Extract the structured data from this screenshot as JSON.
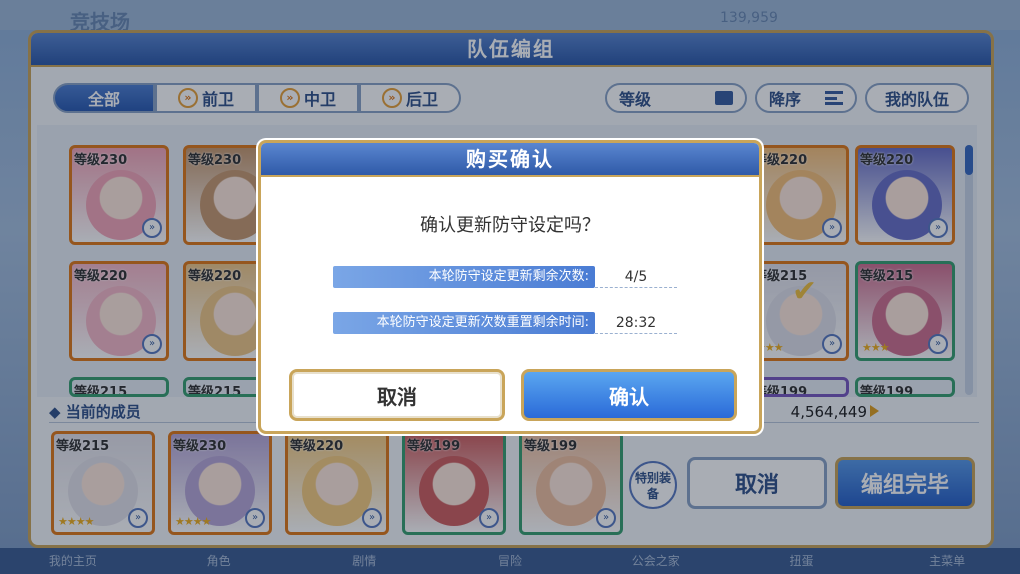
{
  "background": {
    "title": "竞技场",
    "number": "139,959",
    "nav": [
      "我的主页",
      "角色",
      "剧情",
      "冒险",
      "公会之家",
      "扭蛋",
      "主菜单"
    ]
  },
  "main": {
    "title": "队伍编组",
    "filters": [
      {
        "label": "全部",
        "icon": "all"
      },
      {
        "label": "前卫",
        "icon": "chevron-double-icon"
      },
      {
        "label": "中卫",
        "icon": "chevron-double-icon"
      },
      {
        "label": "后卫",
        "icon": "chevron-double-icon"
      }
    ],
    "sort": {
      "level_label": "等级",
      "order_label": "降序",
      "my_team_label": "我的队伍"
    },
    "grid_cards": [
      {
        "level": "等级230",
        "color": "#f4a6b8"
      },
      {
        "level": "等级230",
        "color": "#c89a70"
      },
      {
        "level": "等级220",
        "color": "#f6c07a"
      },
      {
        "level": "等级220",
        "color": "#6a70c8"
      },
      {
        "level": "等级220",
        "color": "#f6b8c8"
      },
      {
        "level": "等级220",
        "color": "#f0c888"
      },
      {
        "level": "等级215",
        "color": "#e0e0ea"
      },
      {
        "level": "等级215",
        "color": "#d07090"
      },
      {
        "level": "等级215",
        "color": "#a0c0e0"
      },
      {
        "level": "等级215",
        "color": "#b0d0a0"
      },
      {
        "level": "等级199",
        "color": "#e0b0c8"
      },
      {
        "level": "等级199",
        "color": "#c8c0e8"
      }
    ],
    "members_title": "当前的成员",
    "power": "4,564,449",
    "members": [
      {
        "level": "等级215",
        "color": "#e4e2ea",
        "stars": "★★★★",
        "frame": "orange"
      },
      {
        "level": "等级230",
        "color": "#b8a8d8",
        "stars": "★★★★",
        "frame": "orange"
      },
      {
        "level": "等级220",
        "color": "#f6cc80",
        "stars": "",
        "frame": "orange"
      },
      {
        "level": "等级199",
        "color": "#d06060",
        "stars": "",
        "frame": "green"
      },
      {
        "level": "等级199",
        "color": "#f0c0a0",
        "stars": "",
        "frame": "green"
      }
    ],
    "equip_label": "特别装备",
    "cancel_label": "取消",
    "complete_label": "编组完毕"
  },
  "dialog": {
    "title": "购买确认",
    "message": "确认更新防守设定吗？",
    "rows": [
      {
        "label": "本轮防守设定更新剩余次数:",
        "value": "4/5"
      },
      {
        "label": "本轮防守设定更新次数重置剩余时间:",
        "value": "28:32"
      }
    ],
    "cancel_label": "取消",
    "confirm_label": "确认"
  }
}
